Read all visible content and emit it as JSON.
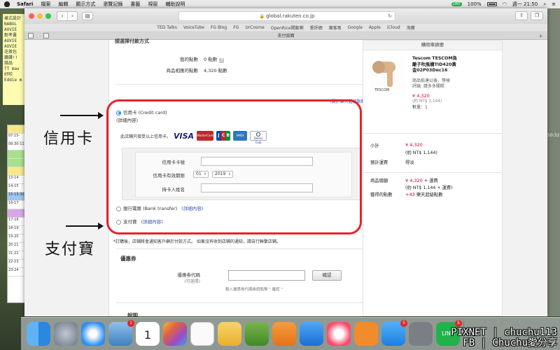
{
  "menubar": {
    "app": "Safari",
    "items": [
      "檔案",
      "編輯",
      "顯示方式",
      "瀏覽記錄",
      "書籤",
      "視窗",
      "輔助說明"
    ],
    "line_badge": "LINE",
    "battery": "100%",
    "clock": "週一 21:50"
  },
  "desktop": {
    "sticky_lines": [
      "樣式設計",
      "NABUL",
      "AUVIE",
      "耐考畫",
      "AUVIE",
      "AUVIE",
      "花茶包",
      "",
      "鏡護!!",
      "錢品",
      "TT max",
      "好吹",
      "Eddie m"
    ],
    "calendar_slots": [
      "",
      "07:15-",
      "09:30-11",
      "",
      "",
      "",
      "13-14",
      "14-15",
      "15-15:30",
      "16-17",
      "",
      "17-18",
      "18-19",
      "19-20",
      "20-21",
      "21-22",
      "22-23",
      "23-24"
    ],
    "right_time": "10:32"
  },
  "browser": {
    "url": "global.rakuten.co.jp",
    "bookmarks": [
      "TED Talks",
      "VoiceTube",
      "FG Blog",
      "FG",
      "UrCosme",
      "OpenRice開飯喇",
      "愛評網",
      "萬客島",
      "Google",
      "Apple",
      "iCloud",
      "淘寶"
    ],
    "tab_title": "支付頁面"
  },
  "checkout": {
    "section_title_cut": "請選擇付款方式",
    "my_points_label": "我的點數",
    "my_points_value": "0 點數",
    "product_points_label": "商品相應的點數",
    "product_points_value": "4,320 點數",
    "points_link": "(關於樂天超級點數)",
    "credit_label": "信用卡 (Credit card)",
    "credit_detail": "(詳細內容)",
    "accept_text": "此店鋪只接受以上信用卡。",
    "card_brands": {
      "visa": "VISA",
      "mastercard": "MasterCard",
      "jcb": "JCB",
      "amex": "AMEX",
      "diners": "Diners Club"
    },
    "card_number_label": "信用卡卡號",
    "expiry_label": "信用卡有效期限",
    "expiry_month": "01",
    "expiry_year": "2019",
    "holder_label": "持卡人姓名",
    "bank_label": "銀行電匯 (Bank transfer)",
    "bank_detail": "(詳細內容)",
    "alipay_label": "支付寶",
    "alipay_detail": "(詳細內容)",
    "notice": "*訂購後，店鋪將會通知客戶顧於付款方式。 如果沒有收到店鋪的通知，請自行聯繫店鋪。",
    "coupon_title": "優惠券",
    "coupon_label": "優惠券代碼",
    "coupon_optional": "(可選擇)",
    "coupon_button": "確認",
    "coupon_hint": "輸入優惠券代碼後請點擊 \" 確認 \"",
    "desc_title": "說明"
  },
  "summary": {
    "header": "購物車摘要",
    "product_name_lines": [
      "Tescom TESCOM負",
      "離子吹風機TID420黃",
      "金02P03Dec16"
    ],
    "shipping_note_lines": [
      "商品抵達以後，等候",
      "評論: 請多多關照"
    ],
    "price": "¥ 4,320",
    "price_ntd": "(約 NT$ 1,144)",
    "qty": "數量：1",
    "subtotal_label": "小計",
    "subtotal": "¥ 4,320",
    "subtotal_ntd": "(約 NT$ 1,144)",
    "shipping_label": "預計運費",
    "shipping_value": "得淡",
    "total_label": "商品總額",
    "total": "¥ 4,320",
    "total_suffix": "+ 運費",
    "total_ntd": "(約 NT$ 1,144 + 運費)",
    "points_label": "獲得的點數",
    "points": "+43",
    "points_suffix": "樂天超級點數"
  },
  "annotations": {
    "credit_card": "信用卡",
    "alipay": "支付寶"
  },
  "dock": {
    "badge_mail": "1",
    "badge_calendar_day": "1",
    "badge_appstore": "5",
    "badge_line": "5"
  },
  "watermark": [
    "PIXNET | chuchu113",
    "FB | Chuchu愛分享"
  ],
  "colors": {
    "accent_blue": "#2d7ee5",
    "price_red": "#d0021b",
    "annotation_red": "#e3242b"
  }
}
